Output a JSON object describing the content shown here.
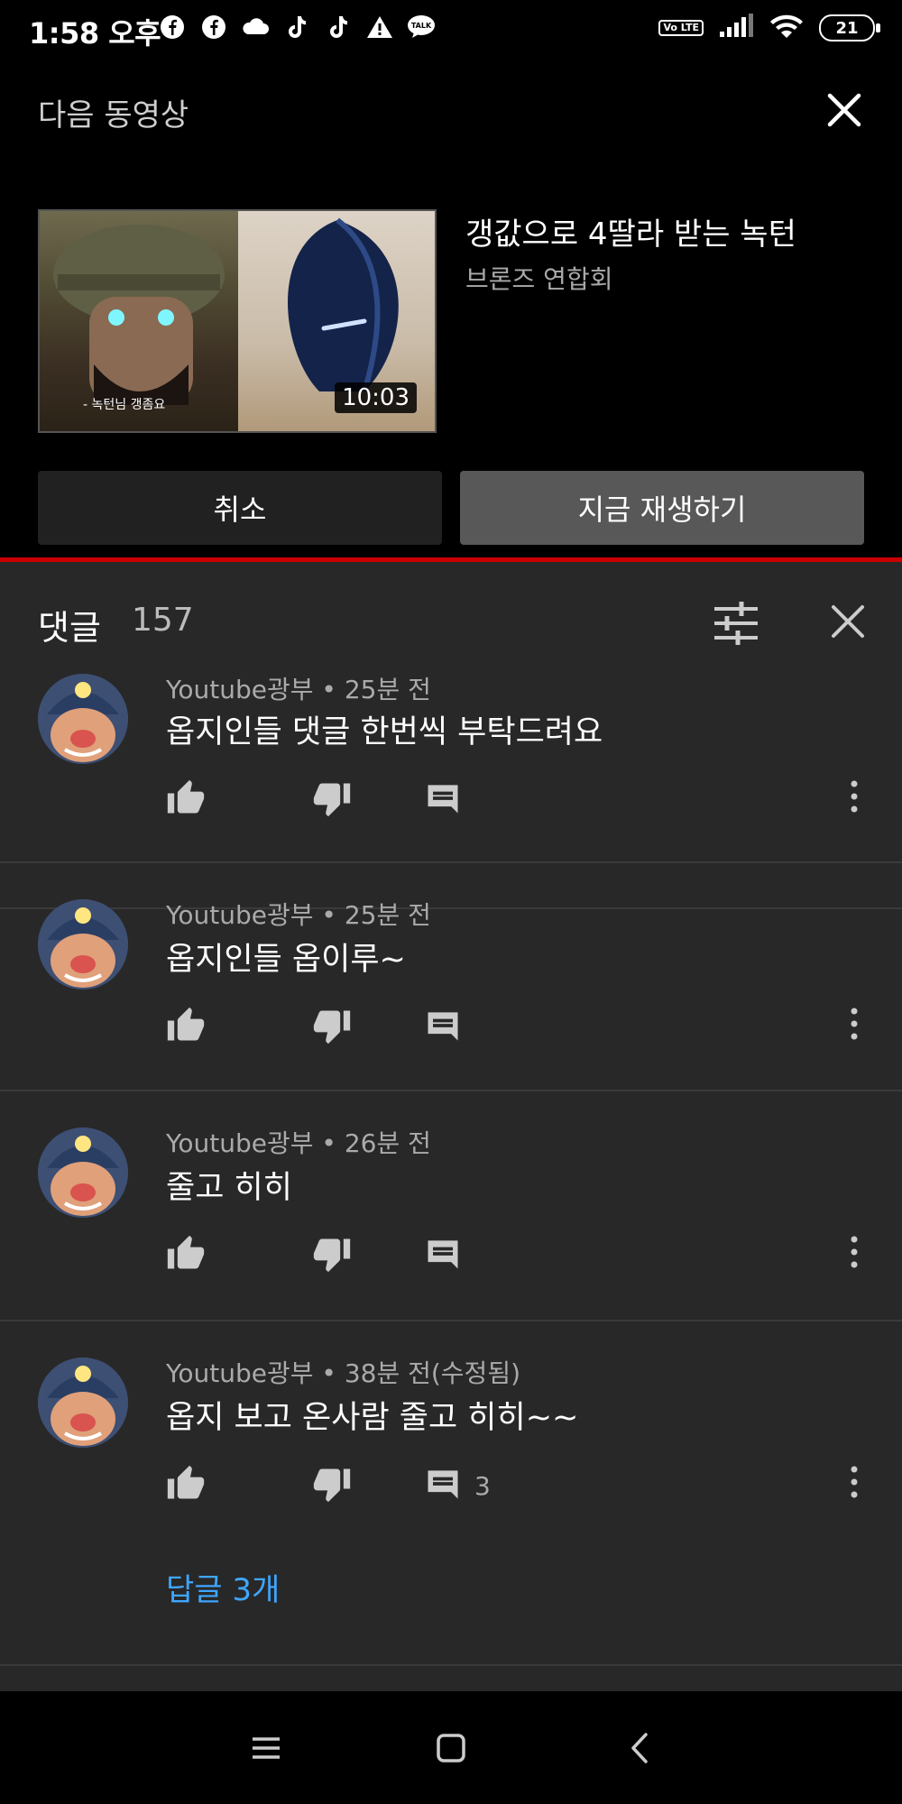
{
  "status_bar": {
    "time": "1:58 오후",
    "battery": "21",
    "left_icons": [
      "facebook-icon",
      "facebook-icon",
      "cloud-icon",
      "tiktok-icon",
      "tiktok-icon",
      "warning-icon",
      "talk-icon"
    ],
    "volte_label": "Vo LTE"
  },
  "up_next": {
    "header": "다음 동영상",
    "video_title": "갱값으로 4딸라 받는 녹턴",
    "channel": "브론즈 연합회",
    "duration": "10:03",
    "thumb_caption": "- 녹턴님 갱좀요",
    "cancel_label": "취소",
    "play_label": "지금 재생하기"
  },
  "comments": {
    "title": "댓글",
    "count": "157",
    "items": [
      {
        "author_meta": "Youtube광부 • 25분 전",
        "text": "옵지인들 댓글 한번씩 부탁드려요",
        "reply_count": ""
      },
      {
        "author_meta": "Youtube광부 • 25분 전",
        "text": "옵지인들 옵이루~",
        "reply_count": ""
      },
      {
        "author_meta": "Youtube광부 • 26분 전",
        "text": "줄고 히히",
        "reply_count": ""
      },
      {
        "author_meta": "Youtube광부 • 38분 전(수정됨)",
        "text": "옵지 보고 온사람 줄고 히히~~",
        "reply_count": "3",
        "replies_link": "답글 3개"
      }
    ]
  },
  "colors": {
    "panel_bg": "#282828",
    "accent_red": "#cc0000",
    "link_blue": "#3ea6ff"
  }
}
